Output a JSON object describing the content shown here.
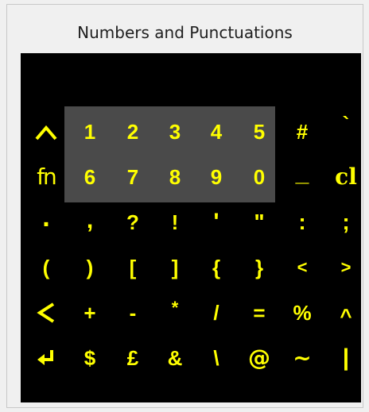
{
  "panel": {
    "title": "Numbers and Punctuations"
  },
  "colors": {
    "key": "#ffff00",
    "background": "#000000",
    "highlight": "#4a4a4a"
  },
  "rows": [
    [
      {
        "icon": "caret-up-icon"
      },
      {
        "label": "1"
      },
      {
        "label": "2"
      },
      {
        "label": "3"
      },
      {
        "label": "4"
      },
      {
        "label": "5"
      },
      {
        "label": "#"
      },
      {
        "label": "`"
      }
    ],
    [
      {
        "label": "fn"
      },
      {
        "label": "6"
      },
      {
        "label": "7"
      },
      {
        "label": "8"
      },
      {
        "label": "9"
      },
      {
        "label": "0"
      },
      {
        "label": "_"
      },
      {
        "label": "cl"
      }
    ],
    [
      {
        "label": "."
      },
      {
        "label": ","
      },
      {
        "label": "?"
      },
      {
        "label": "!"
      },
      {
        "label": "'"
      },
      {
        "label": "\""
      },
      {
        "label": ":"
      },
      {
        "label": ";"
      }
    ],
    [
      {
        "label": "("
      },
      {
        "label": ")"
      },
      {
        "label": "["
      },
      {
        "label": "]"
      },
      {
        "label": "{"
      },
      {
        "label": "}"
      },
      {
        "label": "<"
      },
      {
        "label": ">"
      }
    ],
    [
      {
        "icon": "backspace-arrow-icon"
      },
      {
        "label": "+"
      },
      {
        "label": "-"
      },
      {
        "label": "*"
      },
      {
        "label": "/"
      },
      {
        "label": "="
      },
      {
        "label": "%"
      },
      {
        "label": "^"
      }
    ],
    [
      {
        "icon": "enter-icon"
      },
      {
        "label": "$"
      },
      {
        "label": "£"
      },
      {
        "label": "&"
      },
      {
        "label": "\\"
      },
      {
        "label": "@"
      },
      {
        "label": "~"
      },
      {
        "label": "|"
      }
    ]
  ]
}
